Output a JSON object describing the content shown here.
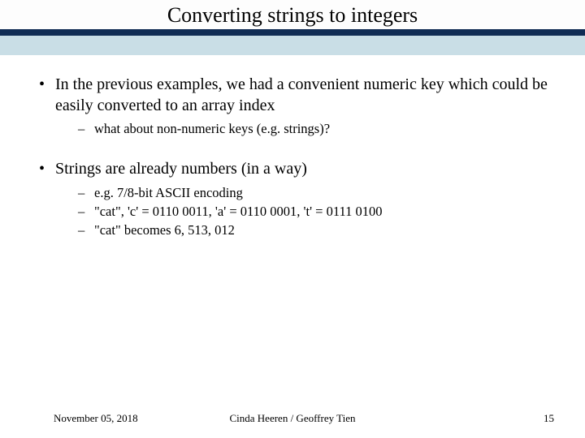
{
  "title": "Converting strings to integers",
  "bullets": [
    {
      "text": "In the previous examples, we had a convenient numeric key which could be easily converted to an array index",
      "sub": [
        "what about non-numeric keys (e.g. strings)?"
      ]
    },
    {
      "text": "Strings are already numbers (in a way)",
      "sub": [
        "e.g. 7/8-bit ASCII encoding",
        "\"cat\", 'c' = 0110 0011, 'a' = 0110 0001, 't' = 0111 0100",
        "\"cat\" becomes 6, 513, 012"
      ]
    }
  ],
  "footer": {
    "date": "November 05, 2018",
    "authors": "Cinda Heeren / Geoffrey Tien",
    "page": "15"
  }
}
